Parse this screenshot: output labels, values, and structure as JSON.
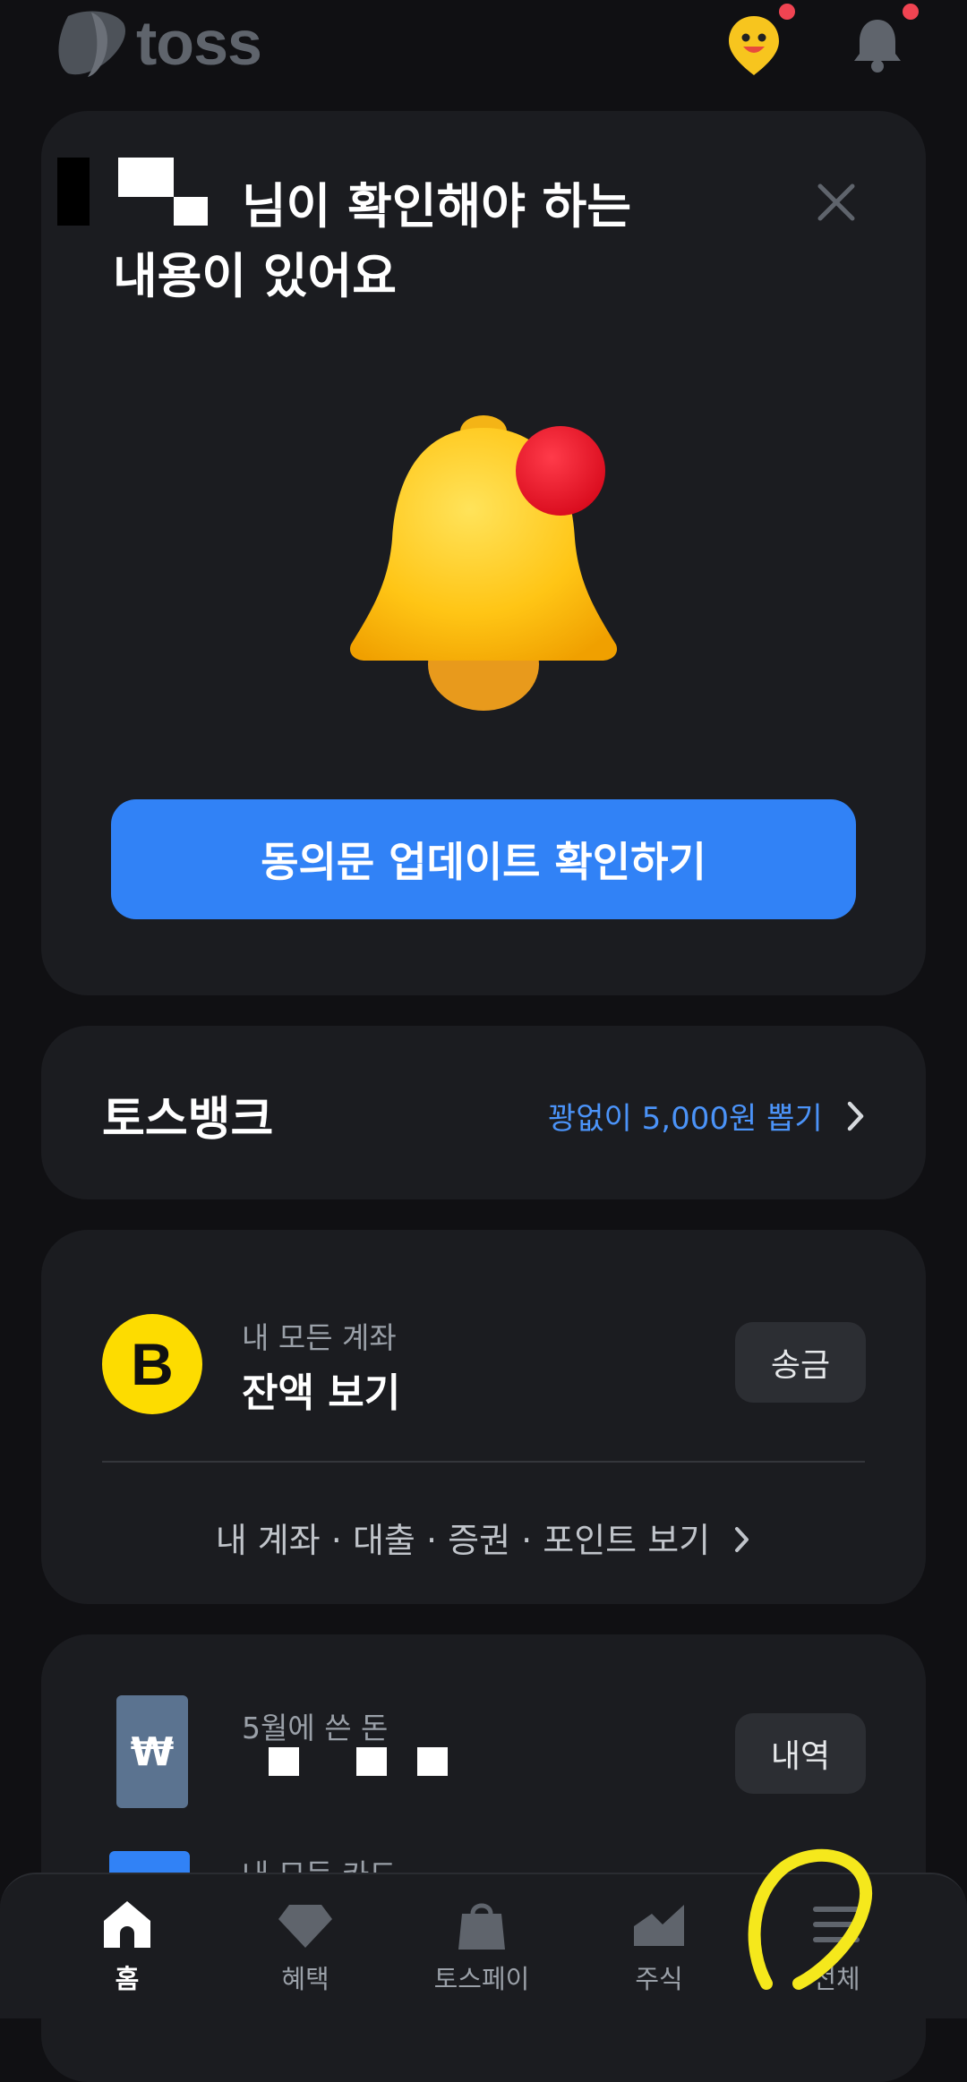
{
  "header": {
    "logo_text": "toss",
    "icons": [
      "toss-face-icon",
      "bell-icon"
    ]
  },
  "notice": {
    "title_line1": "님이 확인해야 하는",
    "title_line2": "내용이 있어요",
    "button_label": "동의문 업데이트 확인하기"
  },
  "tossbank": {
    "title": "토스뱅크",
    "link": "꽝없이 5,000원 뽑기"
  },
  "accounts": {
    "logo_letter": "B",
    "sub_label": "내 모든 계좌",
    "main_label": "잔액 보기",
    "button_label": "송금",
    "bottom_link": "내 계좌 · 대출 · 증권 · 포인트 보기"
  },
  "spending": {
    "card_symbol": "₩",
    "sub_label": "5월에 쓴 돈",
    "button_label": "내역",
    "next_label": "내 모든 카드"
  },
  "tabs": [
    {
      "label": "홈",
      "icon": "home-icon",
      "active": true
    },
    {
      "label": "혜택",
      "icon": "diamond-icon",
      "active": false
    },
    {
      "label": "토스페이",
      "icon": "shopping-bag-icon",
      "active": false
    },
    {
      "label": "주식",
      "icon": "stock-chart-icon",
      "active": false
    },
    {
      "label": "전체",
      "icon": "menu-icon",
      "active": false
    }
  ],
  "colors": {
    "background": "#101013",
    "card": "#1b1c20",
    "accent": "#3182f6",
    "link": "#4b93f8",
    "badge": "#f04452",
    "highlight": "#f5e81c"
  }
}
